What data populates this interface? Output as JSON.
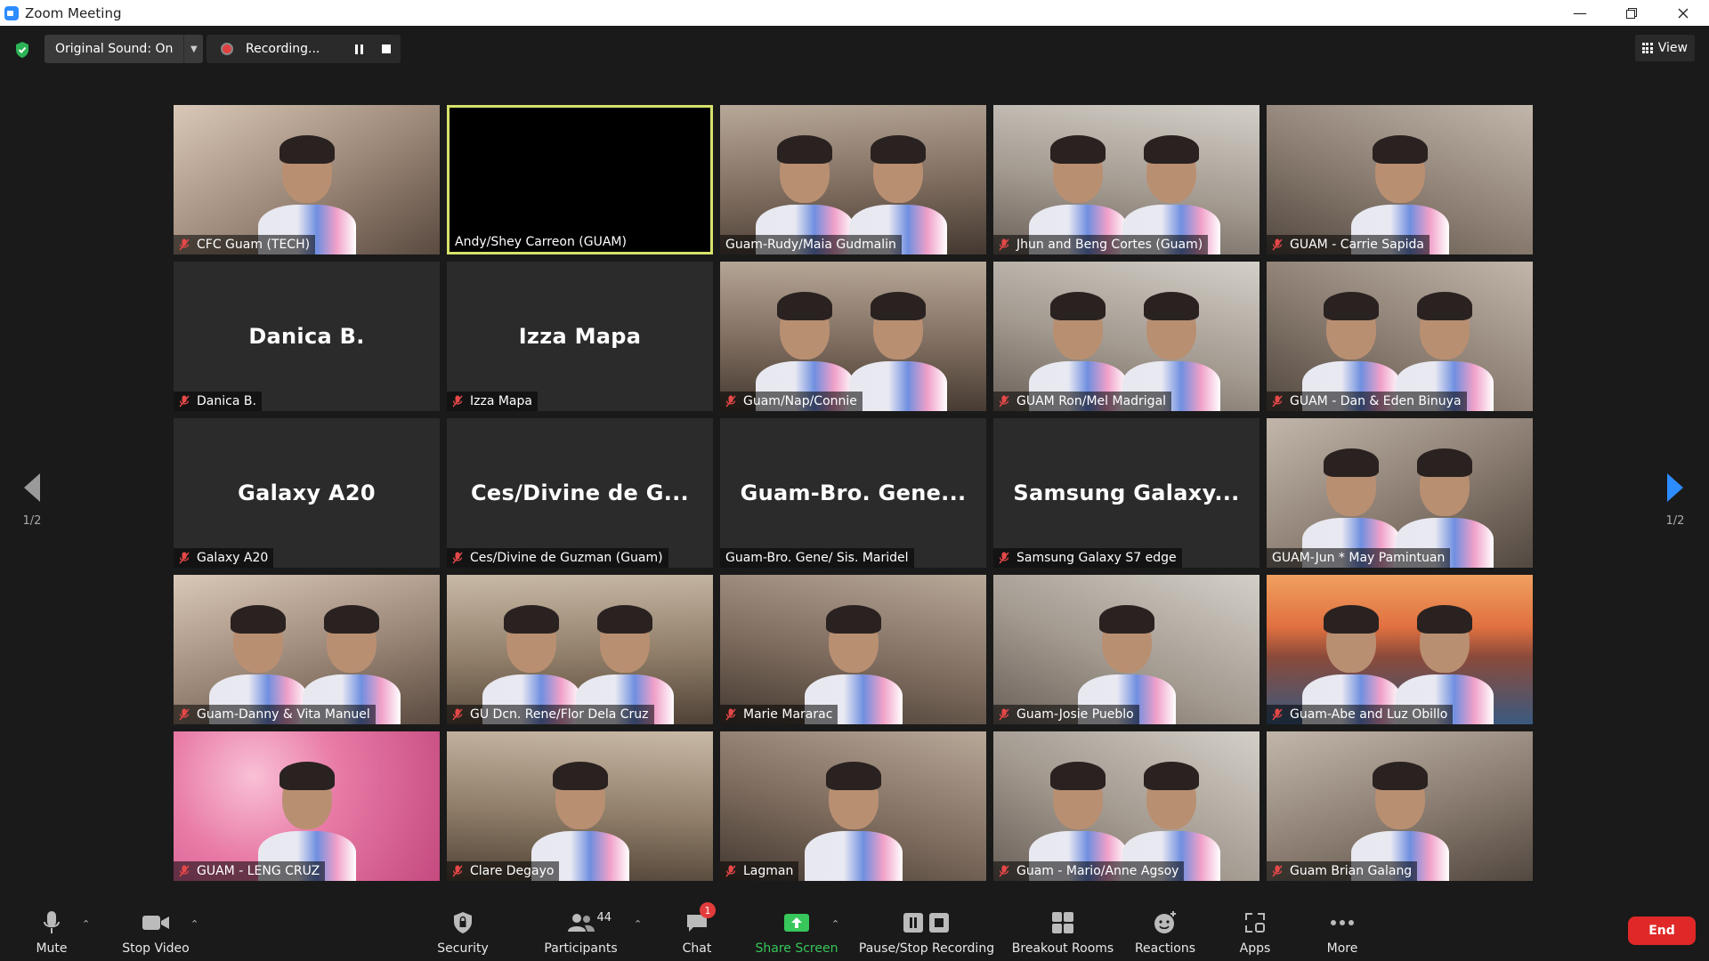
{
  "window": {
    "title": "Zoom Meeting"
  },
  "topbar": {
    "original_sound_label": "Original Sound: On",
    "recording_label": "Recording...",
    "view_label": "View"
  },
  "gallery": {
    "page_indicator": "1/2",
    "tiles": [
      {
        "name": "CFC Guam (TECH)",
        "muted": true,
        "video": true
      },
      {
        "name": "Andy/Shey Carreon (GUAM)",
        "muted": false,
        "video": false,
        "active": true
      },
      {
        "name": "Guam-Rudy/Maia Gudmalin",
        "muted": false,
        "video": true
      },
      {
        "name": "Jhun and Beng Cortes (Guam)",
        "muted": true,
        "video": true
      },
      {
        "name": "GUAM - Carrie Sapida",
        "muted": true,
        "video": true
      },
      {
        "name": "Danica B.",
        "muted": true,
        "video": false,
        "display": "Danica B."
      },
      {
        "name": "Izza Mapa",
        "muted": true,
        "video": false,
        "display": "Izza Mapa"
      },
      {
        "name": "Guam/Nap/Connie",
        "muted": true,
        "video": true
      },
      {
        "name": "GUAM Ron/Mel Madrigal",
        "muted": true,
        "video": true
      },
      {
        "name": "GUAM - Dan & Eden Binuya",
        "muted": true,
        "video": true
      },
      {
        "name": "Galaxy A20",
        "muted": true,
        "video": false,
        "display": "Galaxy A20"
      },
      {
        "name": "Ces/Divine de Guzman (Guam)",
        "muted": true,
        "video": false,
        "display": "Ces/Divine de G..."
      },
      {
        "name": "Guam-Bro. Gene/ Sis. Maridel",
        "muted": false,
        "video": false,
        "display": "Guam-Bro. Gene..."
      },
      {
        "name": "Samsung Galaxy S7 edge",
        "muted": true,
        "video": false,
        "display": "Samsung Galaxy..."
      },
      {
        "name": "GUAM-Jun * May Pamintuan",
        "muted": false,
        "video": true
      },
      {
        "name": "Guam-Danny & Vita Manuel",
        "muted": true,
        "video": true
      },
      {
        "name": "GU Dcn. Rene/Flor Dela Cruz",
        "muted": true,
        "video": true
      },
      {
        "name": "Marie Mararac",
        "muted": true,
        "video": true
      },
      {
        "name": "Guam-Josie Pueblo",
        "muted": true,
        "video": true
      },
      {
        "name": "Guam-Abe and Luz Obillo",
        "muted": true,
        "video": true
      },
      {
        "name": "GUAM - LENG CRUZ",
        "muted": true,
        "video": true
      },
      {
        "name": "Clare Degayo",
        "muted": true,
        "video": true
      },
      {
        "name": "Lagman",
        "muted": true,
        "video": true
      },
      {
        "name": "Guam - Mario/Anne Agsoy",
        "muted": true,
        "video": true
      },
      {
        "name": "Guam Brian Galang",
        "muted": true,
        "video": true
      }
    ]
  },
  "toolbar": {
    "mute": "Mute",
    "stop_video": "Stop Video",
    "security": "Security",
    "participants": "Participants",
    "participants_count": "44",
    "chat": "Chat",
    "chat_badge": "1",
    "share_screen": "Share Screen",
    "pause_stop_recording": "Pause/Stop Recording",
    "breakout_rooms": "Breakout Rooms",
    "reactions": "Reactions",
    "apps": "Apps",
    "more": "More",
    "end": "End"
  },
  "colors": {
    "accent_blue": "#2d8cff",
    "end_red": "#e02828",
    "share_green": "#37c75a",
    "active_border": "#d6e26b"
  }
}
